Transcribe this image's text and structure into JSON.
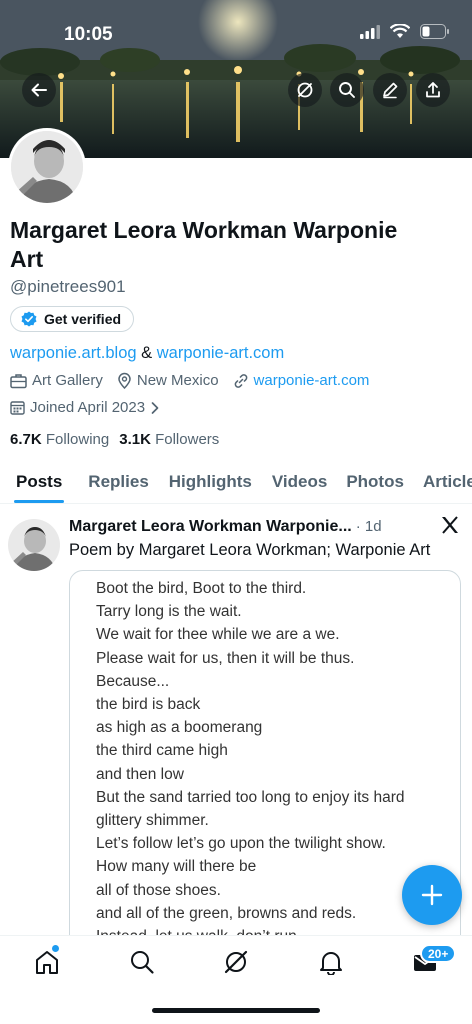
{
  "status": {
    "time": "10:05"
  },
  "profile": {
    "name": "Margaret Leora Workman Warponie Art",
    "handle": "@pinetrees901",
    "verify_label": "Get verified",
    "link1": "warponie.art.blog",
    "link_sep": " & ",
    "link2": "warponie-art.com",
    "category": "Art Gallery",
    "location": "New Mexico",
    "website": "warponie-art.com",
    "joined": "Joined April 2023",
    "following_count": "6.7K",
    "following_label": "Following",
    "followers_count": "3.1K",
    "followers_label": "Followers"
  },
  "tabs": [
    "Posts",
    "Replies",
    "Highlights",
    "Videos",
    "Photos",
    "Articles"
  ],
  "post": {
    "author": "Margaret Leora Workman Warponie...",
    "time": "· 1d",
    "text": "Poem by Margaret Leora Workman; Warponie Art",
    "poem_lines": [
      "Boot the bird, Boot to the third.",
      "Tarry long is the wait.",
      "We wait for thee while we are a we.",
      "Please wait for us, then it will be thus.",
      "Because...",
      "the bird is back",
      "as high as a boomerang",
      "the third came high",
      "and then low",
      "But the sand tarried too long to enjoy its hard",
      "glittery shimmer.",
      "Let’s follow let’s go upon the twilight show.",
      "How many will there be",
      "all of those shoes.",
      "and all of the green, browns and reds.",
      "Instead, let us walk, don’t run."
    ]
  },
  "nav": {
    "messages_badge": "20+"
  },
  "colors": {
    "accent": "#1d9bf0",
    "text": "#0f1419",
    "secondary": "#536471"
  }
}
